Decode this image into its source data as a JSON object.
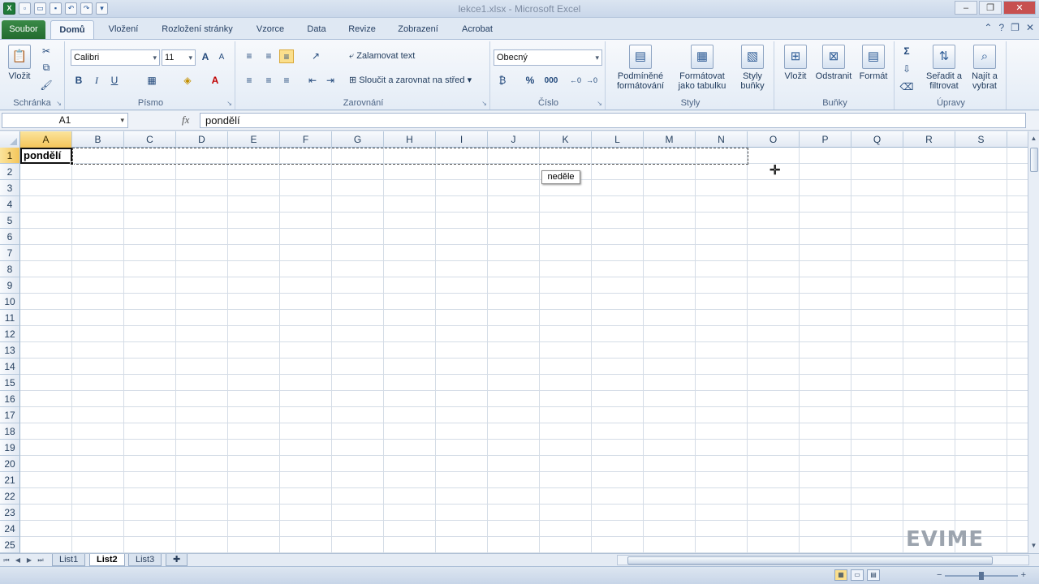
{
  "window": {
    "title": "lekce1.xlsx - Microsoft Excel"
  },
  "tabs": [
    "Soubor",
    "Domů",
    "Vložení",
    "Rozložení stránky",
    "Vzorce",
    "Data",
    "Revize",
    "Zobrazení",
    "Acrobat"
  ],
  "ribbon": {
    "clipboard": {
      "paste": "Vložit",
      "group": "Schránka"
    },
    "font": {
      "name": "Calibri",
      "size": "11",
      "bold": "B",
      "italic": "I",
      "underline": "U",
      "group": "Písmo"
    },
    "alignment": {
      "wrap": "Zalamovat text",
      "merge": "Sloučit a zarovnat na střed",
      "group": "Zarovnání"
    },
    "number": {
      "format": "Obecný",
      "percent": "%",
      "thousands": "000",
      "group": "Číslo"
    },
    "styles": {
      "conditional1": "Podmíněné",
      "conditional2": "formátování",
      "table1": "Formátovat",
      "table2": "jako tabulku",
      "cell1": "Styly",
      "cell2": "buňky",
      "group": "Styly"
    },
    "cells": {
      "insert": "Vložit",
      "delete": "Odstranit",
      "format": "Formát",
      "group": "Buňky"
    },
    "editing": {
      "sort1": "Seřadit a",
      "sort2": "filtrovat",
      "find1": "Najít a",
      "find2": "vybrat",
      "group": "Úpravy"
    }
  },
  "formula_bar": {
    "name_box": "A1",
    "fx": "fx",
    "content": "pondělí"
  },
  "columns": [
    "A",
    "B",
    "C",
    "D",
    "E",
    "F",
    "G",
    "H",
    "I",
    "J",
    "K",
    "L",
    "M",
    "N",
    "O",
    "P",
    "Q",
    "R",
    "S"
  ],
  "rows": [
    "1",
    "2",
    "3",
    "4",
    "5",
    "6",
    "7",
    "8",
    "9",
    "10",
    "11",
    "12",
    "13",
    "14",
    "15",
    "16",
    "17",
    "18",
    "19",
    "20",
    "21",
    "22",
    "23",
    "24",
    "25"
  ],
  "cells": {
    "A1": "pondělí"
  },
  "autofill_tip": "neděle",
  "watermark": "EVIME",
  "sheets": [
    "List1",
    "List2",
    "List3"
  ],
  "active_sheet": "List2"
}
